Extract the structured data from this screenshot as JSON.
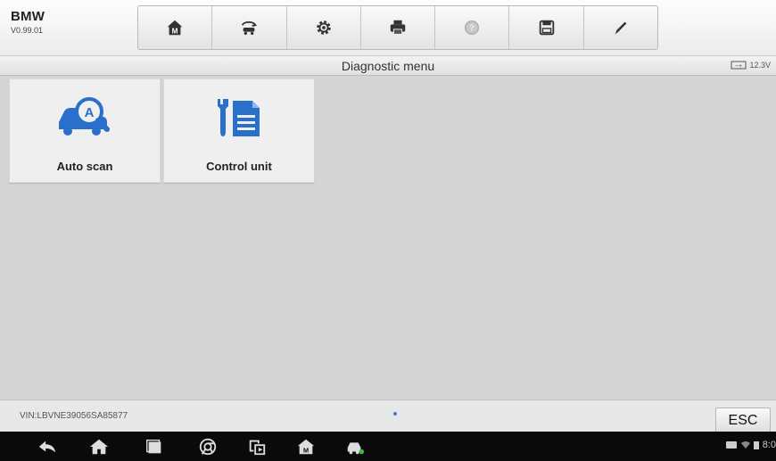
{
  "toolbar": {
    "brand": "BMW",
    "version": "V0.99.01",
    "buttons": [
      {
        "icon": "home-icon"
      },
      {
        "icon": "vehicle-swap-icon"
      },
      {
        "icon": "settings-icon"
      },
      {
        "icon": "print-icon"
      },
      {
        "icon": "help-icon"
      },
      {
        "icon": "save-icon"
      },
      {
        "icon": "pen-icon"
      }
    ]
  },
  "titlebar": {
    "title": "Diagnostic menu",
    "battery_voltage": "12.3V"
  },
  "tiles": [
    {
      "label": "Auto scan",
      "icon": "car-auto-scan-icon",
      "color": "#2a6fc9"
    },
    {
      "label": "Control unit",
      "icon": "wrench-document-icon",
      "color": "#2a6fc9"
    }
  ],
  "footer": {
    "vin": "VIN:LBVNE39056SA85877",
    "vin_line2": "",
    "esc_label": "ESC"
  },
  "navbar": {
    "items": [
      "back-icon",
      "home-icon",
      "recent-apps-icon",
      "browser-icon",
      "screenshot-icon",
      "app-home-icon",
      "vci-car-icon"
    ],
    "clock": "8:0"
  }
}
